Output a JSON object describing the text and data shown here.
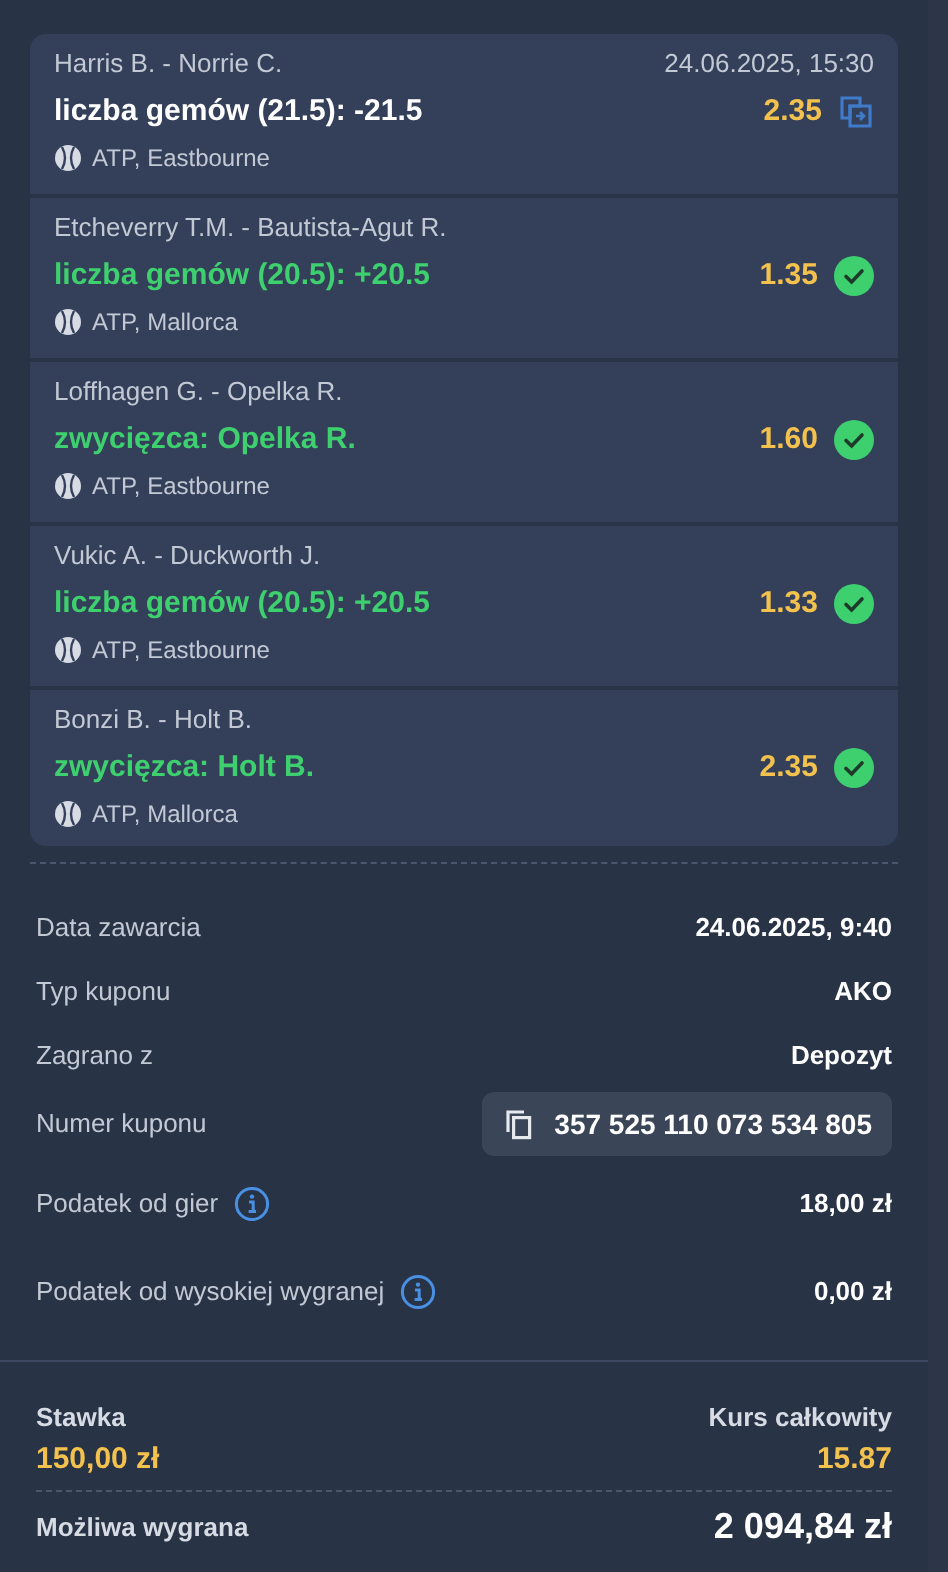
{
  "bets": [
    {
      "match": "Harris B. - Norrie C.",
      "datetime": "24.06.2025, 15:30",
      "selection": "liczba gemów (21.5): -21.5",
      "odds": "2.35",
      "won": false,
      "league": "ATP, Eastbourne"
    },
    {
      "match": "Etcheverry T.M. - Bautista-Agut R.",
      "selection": "liczba gemów (20.5): +20.5",
      "odds": "1.35",
      "won": true,
      "league": "ATP, Mallorca"
    },
    {
      "match": "Loffhagen G. - Opelka R.",
      "selection": "zwycięzca: Opelka R.",
      "odds": "1.60",
      "won": true,
      "league": "ATP, Eastbourne"
    },
    {
      "match": "Vukic A. - Duckworth J.",
      "selection": "liczba gemów (20.5): +20.5",
      "odds": "1.33",
      "won": true,
      "league": "ATP, Eastbourne"
    },
    {
      "match": "Bonzi B. - Holt B.",
      "selection": "zwycięzca: Holt B.",
      "odds": "2.35",
      "won": true,
      "league": "ATP, Mallorca"
    }
  ],
  "details": [
    {
      "kind": "plain",
      "label": "Data zawarcia",
      "value": "24.06.2025, 9:40"
    },
    {
      "kind": "plain",
      "label": "Typ kuponu",
      "value": "AKO"
    },
    {
      "kind": "plain",
      "label": "Zagrano z",
      "value": "Depozyt"
    },
    {
      "kind": "copy",
      "label": "Numer kuponu",
      "value": "357 525 110 073 534 805"
    },
    {
      "kind": "info",
      "label": "Podatek od gier",
      "value": "18,00 zł"
    },
    {
      "kind": "info",
      "label": "Podatek od wysokiej wygranej",
      "value": "0,00 zł"
    }
  ],
  "summary": {
    "stake_label": "Stawka",
    "stake": "150,00 zł",
    "total_odds_label": "Kurs całkowity",
    "total_odds": "15.87",
    "win_label": "Możliwa wygrana",
    "win": "2 094,84 zł"
  }
}
